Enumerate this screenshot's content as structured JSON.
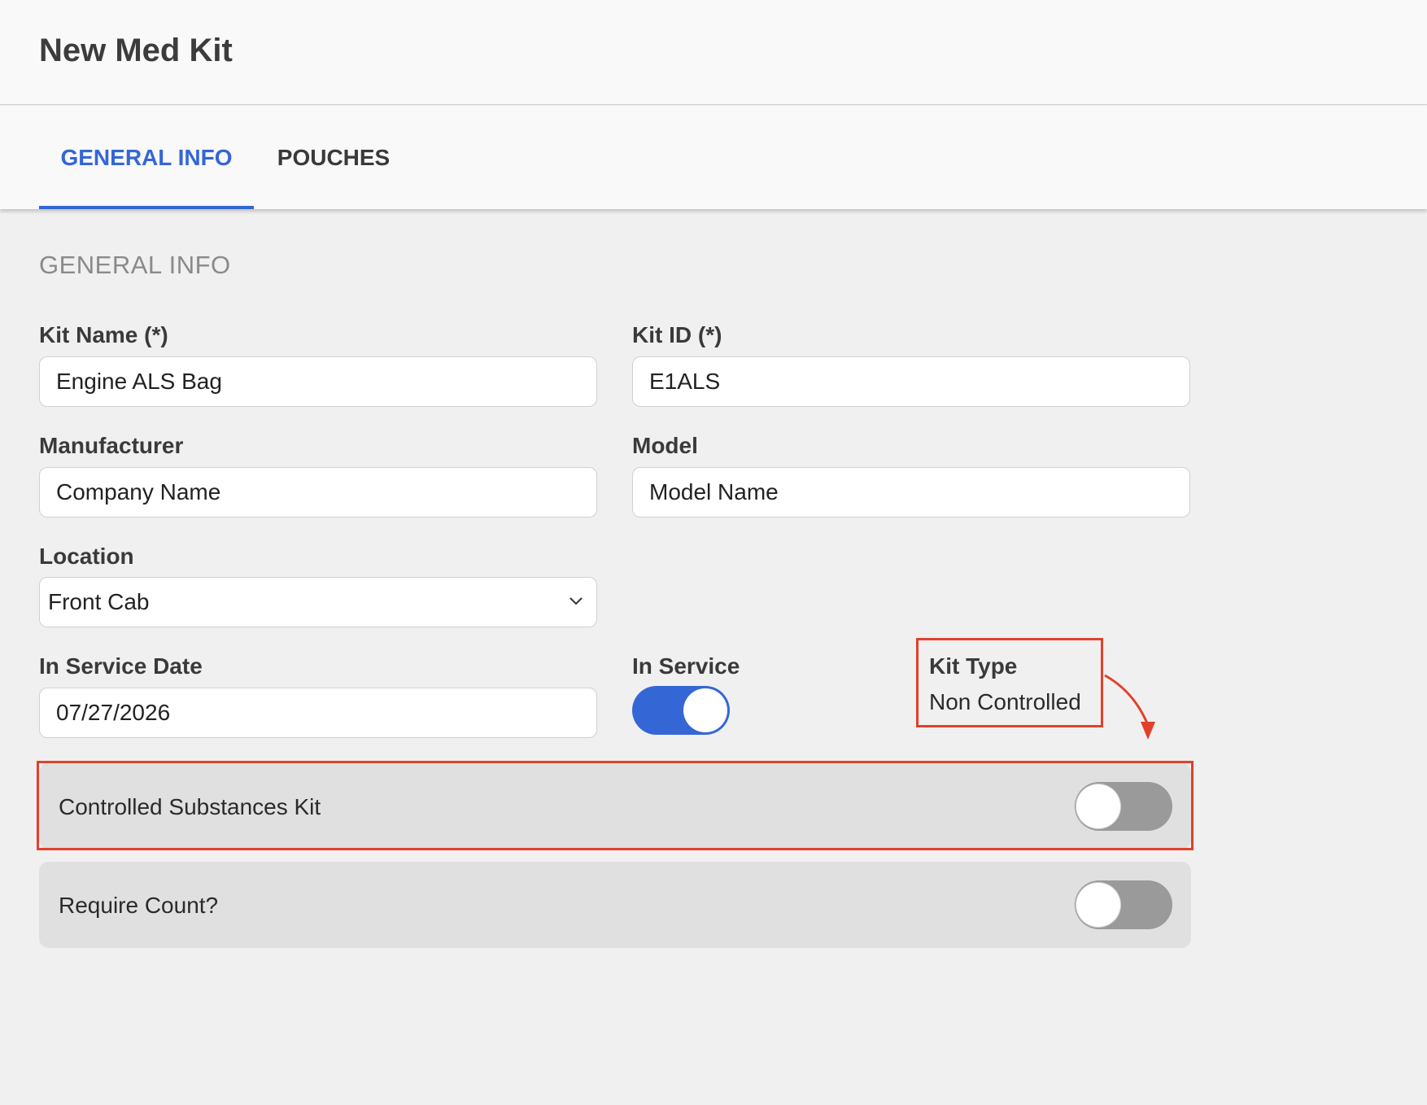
{
  "header": {
    "title": "New Med Kit"
  },
  "tabs": [
    {
      "label": "GENERAL INFO",
      "active": true
    },
    {
      "label": "POUCHES",
      "active": false
    }
  ],
  "section": {
    "title": "GENERAL INFO"
  },
  "form": {
    "kit_name": {
      "label": "Kit Name (*)",
      "value": "Engine ALS Bag"
    },
    "kit_id": {
      "label": "Kit ID (*)",
      "value": "E1ALS"
    },
    "manufacturer": {
      "label": "Manufacturer",
      "value": "Company Name"
    },
    "model": {
      "label": "Model",
      "value": "Model Name"
    },
    "location": {
      "label": "Location",
      "value": "Front Cab"
    },
    "in_service_date": {
      "label": "In Service Date",
      "value": "07/27/2026"
    },
    "in_service": {
      "label": "In Service",
      "checked": true
    },
    "kit_type": {
      "label": "Kit Type",
      "value": "Non Controlled"
    }
  },
  "toggles": [
    {
      "label": "Controlled Substances Kit",
      "checked": false
    },
    {
      "label": "Require Count?",
      "checked": false
    }
  ],
  "colors": {
    "accent": "#3566d6",
    "annotation": "#e2402c",
    "toggle_off": "#9a9a9a"
  }
}
